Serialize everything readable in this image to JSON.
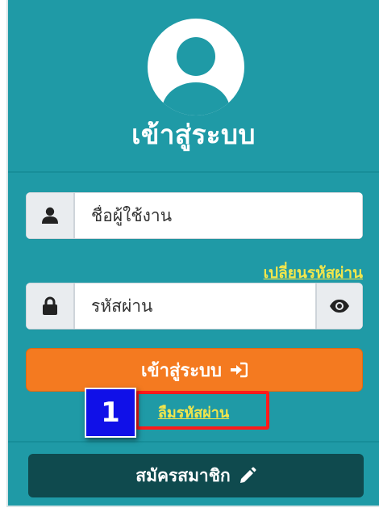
{
  "header": {
    "title": "เข้าสู่ระบบ",
    "avatar_icon": "user-circle-icon"
  },
  "form": {
    "username": {
      "placeholder": "ชื่อผู้ใช้งาน",
      "value": "",
      "icon": "user-icon"
    },
    "change_password_link": "เปลี่ยนรหัสผ่าน",
    "password": {
      "placeholder": "รหัสผ่าน",
      "value": "",
      "icon": "lock-icon",
      "toggle_icon": "eye-icon"
    },
    "login_button": {
      "label": "เข้าสู่ระบบ",
      "icon": "sign-in-icon"
    },
    "forgot_password_link": "ลืมรหัสผ่าน",
    "register_button": {
      "label": "สมัครสมาชิก",
      "icon": "pencil-icon"
    }
  },
  "annotation": {
    "number": "1",
    "highlight_color": "#ff1a1a",
    "badge_color": "#1010e8"
  },
  "colors": {
    "panel_bg": "#1f9aa6",
    "link": "#f2e64b",
    "login_button": "#f47a20",
    "register_button": "#0f4a4e"
  }
}
